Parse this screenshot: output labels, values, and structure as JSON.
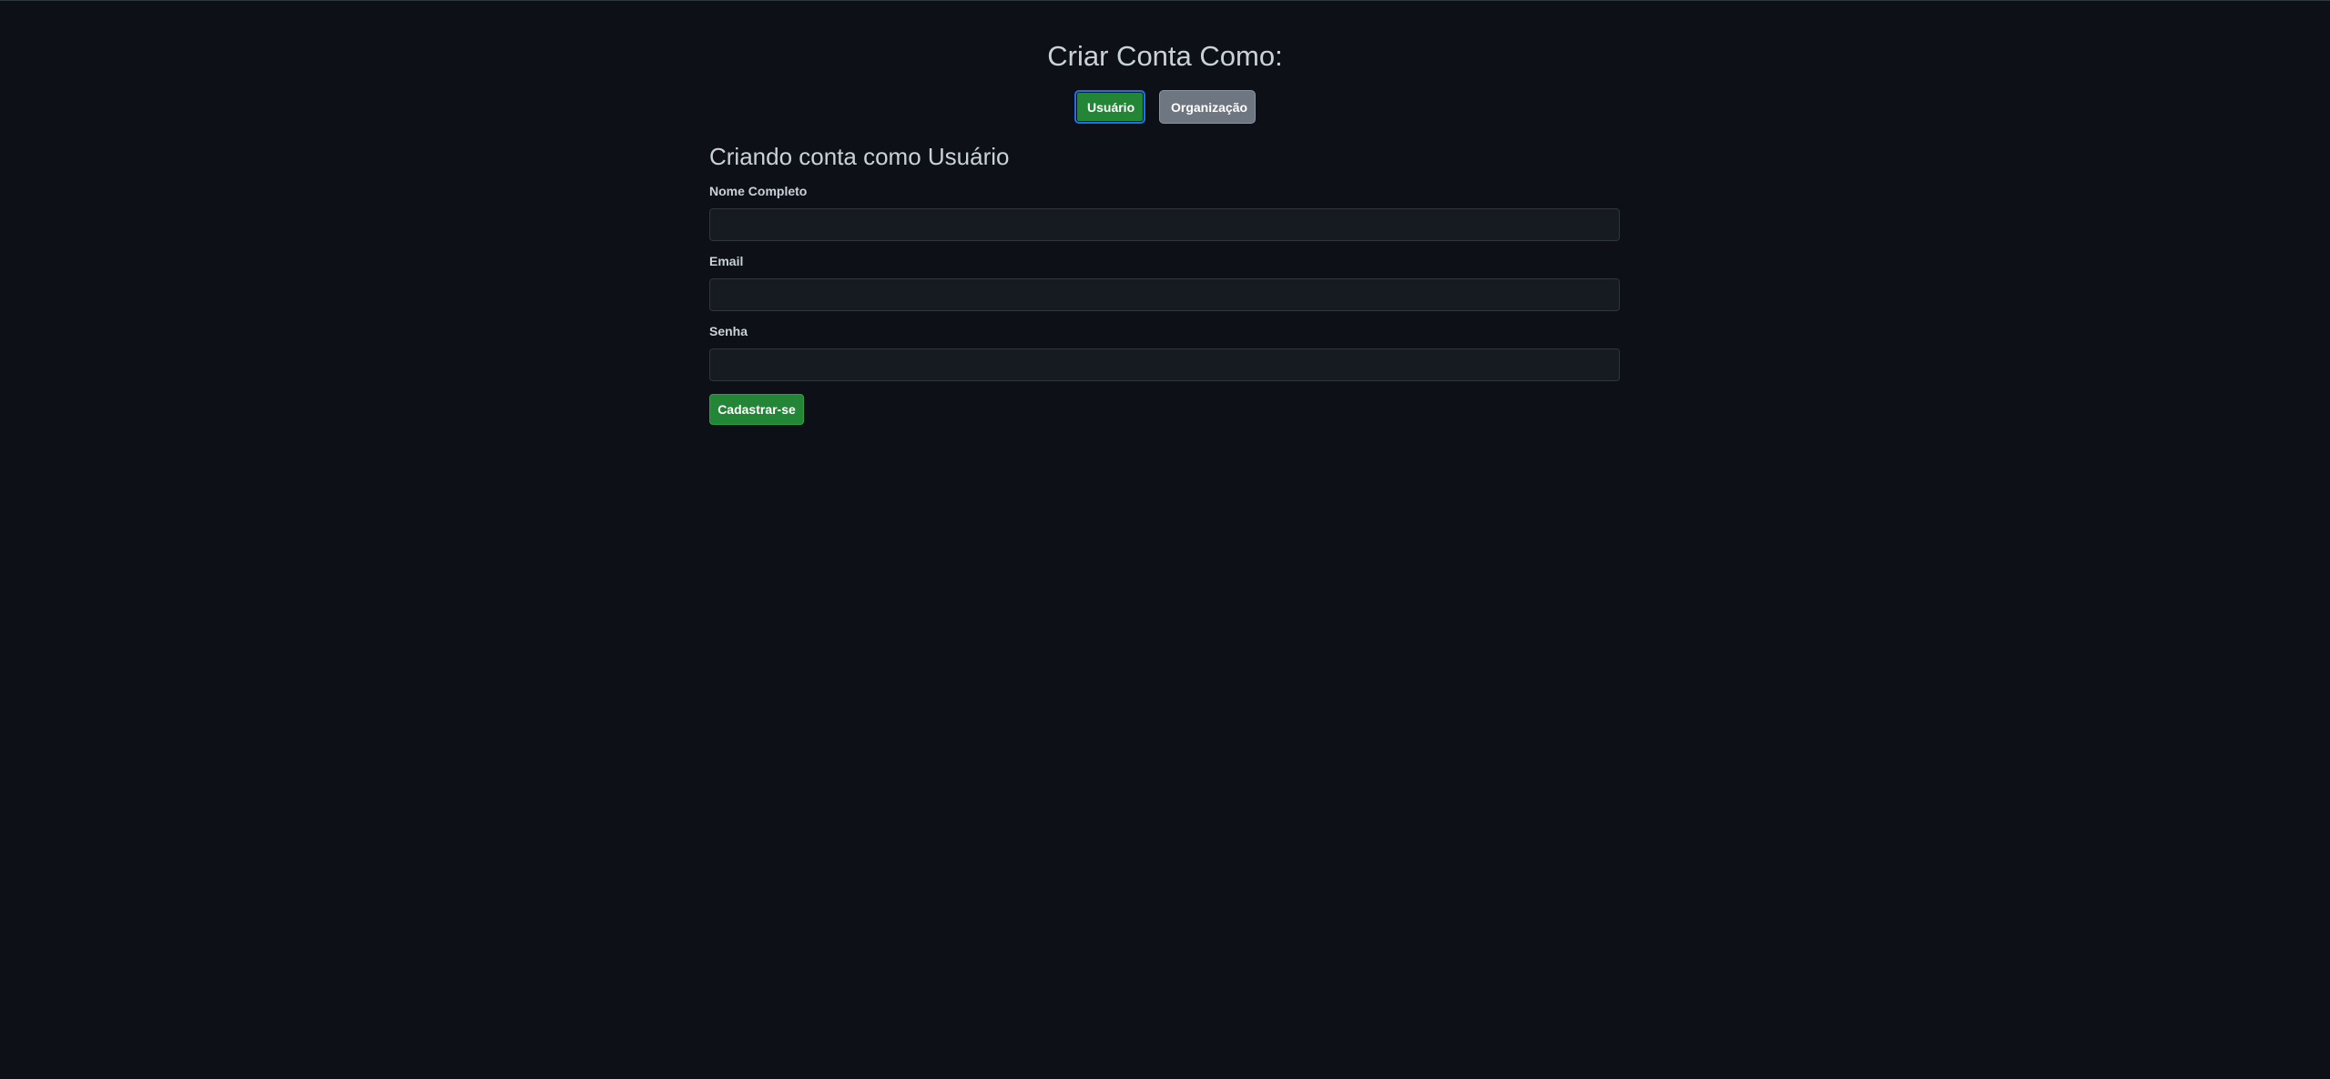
{
  "header": {
    "title": "Criar Conta Como:"
  },
  "account_type": {
    "options": [
      {
        "label": "Usuário",
        "selected": true
      },
      {
        "label": "Organização",
        "selected": false
      }
    ]
  },
  "form": {
    "title": "Criando conta como Usuário",
    "fields": [
      {
        "label": "Nome Completo",
        "value": ""
      },
      {
        "label": "Email",
        "value": ""
      },
      {
        "label": "Senha",
        "value": ""
      }
    ],
    "submit_label": "Cadastrar-se"
  },
  "colors": {
    "background": "#0d1117",
    "primary": "#238636",
    "secondary": "#6e7681",
    "focus_ring": "#1f6feb",
    "input_bg": "#161b22"
  }
}
